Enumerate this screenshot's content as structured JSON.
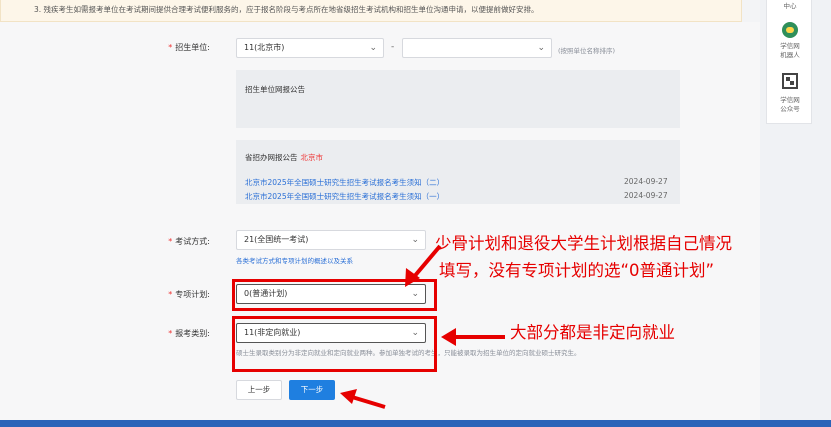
{
  "notice": {
    "text": "3. 残疾考生如需报考单位在考试期间提供合理考试便利服务的，应于报名阶段与考点所在地省级招生考试机构和招生单位沟通申请，以便提前做好安排。"
  },
  "form": {
    "unit": {
      "label": "招生单位:",
      "province_value": "11(北京市)",
      "school_value": "",
      "hint": "(按照单位名称排序)"
    },
    "unit_panel": {
      "title": "招生单位网报公告"
    },
    "province_panel": {
      "title": "省招办网报公告",
      "city": "北京市",
      "items": [
        {
          "title": "北京市2025年全国硕士研究生招生考试报名考生须知（二）",
          "date": "2024-09-27"
        },
        {
          "title": "北京市2025年全国硕士研究生招生考试报名考生须知（一）",
          "date": "2024-09-27"
        }
      ]
    },
    "exam_mode": {
      "label": "考试方式:",
      "value": "21(全国统一考试)",
      "hint": "各类考试方式和专项计划的概述以及关系"
    },
    "special_plan": {
      "label": "专项计划:",
      "value": "0(普通计划)"
    },
    "category": {
      "label": "报考类别:",
      "value": "11(非定向就业)",
      "hint": "硕士生录取类别分为非定向就业和定向就业两种。参加单独考试的考生，只能被录取为招生单位的定向就业硕士研究生。"
    },
    "buttons": {
      "prev": "上一步",
      "next": "下一步"
    }
  },
  "annotations": {
    "plan_note_line1": "少骨计划和退役大学生计划根据自己情况",
    "plan_note_line2": "填写，没有专项计划的选“0普通计划”",
    "category_note": "大部分都是非定向就业"
  },
  "right_rail": {
    "top_text": "中心",
    "robot_label_1": "学信网",
    "robot_label_2": "机器人",
    "qr_label_1": "学信网",
    "qr_label_2": "公众号"
  },
  "colors": {
    "primary": "#1f7fe0",
    "annotation_red": "#e60000",
    "link_blue": "#2a6fd6",
    "required_star": "#e33333"
  }
}
